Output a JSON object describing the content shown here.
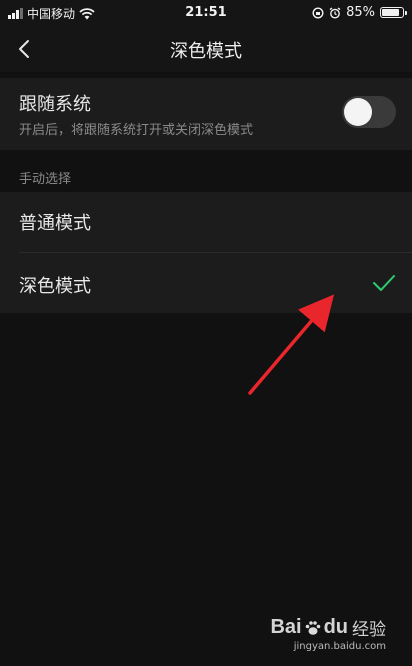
{
  "status_bar": {
    "carrier": "中国移动",
    "time": "21:51",
    "battery": "85%",
    "battery_level": 0.85
  },
  "nav": {
    "title": "深色模式",
    "back_icon": "chevron-left-icon"
  },
  "follow_system": {
    "title": "跟随系统",
    "subtitle": "开启后，将跟随系统打开或关闭深色模式",
    "toggle_on": false
  },
  "manual": {
    "section_label": "手动选择",
    "options": [
      {
        "label": "普通模式",
        "selected": false
      },
      {
        "label": "深色模式",
        "selected": true
      }
    ]
  },
  "colors": {
    "check": "#2ecc71",
    "arrow": "#e8262b",
    "background": "#111111"
  },
  "watermark": {
    "logo": "Bai",
    "logo_suffix": "du",
    "cn": "经验",
    "url": "jingyan.baidu.com"
  }
}
